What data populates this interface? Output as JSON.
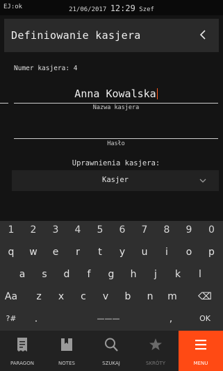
{
  "status_bar": {
    "left": "EJ:ok",
    "date": "21/06/2017",
    "time": "12:29",
    "user": "Szef"
  },
  "title_bar": {
    "title": "Definiowanie kasjera",
    "back_icon": "chevron-left-icon"
  },
  "form": {
    "cashier_number": "Numer kasjera: 4",
    "name_value": "Anna Kowalska",
    "name_label": "Nazwa kasjera",
    "password_value": "",
    "password_label": "Hasło",
    "permissions_label": "Uprawnienia kasjera:",
    "permissions_value": "Kasjer"
  },
  "keyboard": {
    "digits": [
      "1",
      "2",
      "3",
      "4",
      "5",
      "6",
      "7",
      "8",
      "9",
      "0"
    ],
    "row1": [
      "q",
      "w",
      "e",
      "r",
      "t",
      "y",
      "u",
      "i",
      "o",
      "p"
    ],
    "row2": [
      "a",
      "s",
      "d",
      "f",
      "g",
      "h",
      "j",
      "k",
      "l"
    ],
    "row3": [
      "Aa",
      "z",
      "x",
      "c",
      "v",
      "b",
      "n",
      "m",
      "⌫"
    ],
    "row4": [
      "?#",
      ".",
      "———",
      ",",
      "OK"
    ]
  },
  "nav": {
    "items": [
      {
        "label": "PARAGON",
        "icon": "receipt-icon"
      },
      {
        "label": "NOTES",
        "icon": "notebook-icon"
      },
      {
        "label": "SZUKAJ",
        "icon": "search-icon"
      },
      {
        "label": "SKRÓTY",
        "icon": "star-icon"
      },
      {
        "label": "MENU",
        "icon": "menu-icon"
      }
    ],
    "active_color": "#ff4a14"
  }
}
